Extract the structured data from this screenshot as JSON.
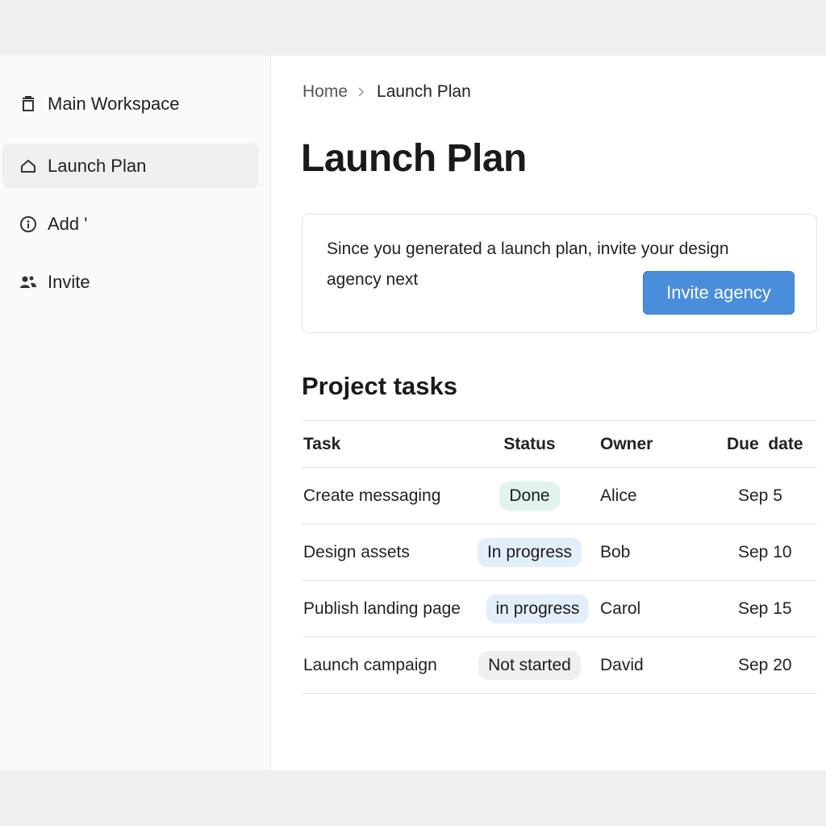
{
  "sidebar": {
    "items": [
      {
        "label": "Main Workspace",
        "icon": "trash-icon"
      },
      {
        "label": "Launch Plan",
        "icon": "home-icon",
        "active": true
      },
      {
        "label": "Add '",
        "icon": "info-circle-icon"
      },
      {
        "label": "Invite",
        "icon": "users-icon"
      }
    ]
  },
  "breadcrumb": {
    "home": "Home",
    "current": "Launch Plan"
  },
  "page": {
    "title": "Launch Plan"
  },
  "callout": {
    "text": "Since you generated a launch plan, invite your design agency next",
    "button_label": "Invite agency"
  },
  "tasks": {
    "title": "Project tasks",
    "columns": [
      "Task",
      "Status",
      "Owner",
      "Due  date"
    ],
    "rows": [
      {
        "task": "Create messaging",
        "status": "Done",
        "owner": "Alice",
        "due": "Sep 5"
      },
      {
        "task": "Design assets",
        "status": "In progress",
        "owner": "Bob",
        "due": "Sep 10"
      },
      {
        "task": "Publish landing page",
        "status": "in progress",
        "owner": "Carol",
        "due": "Sep 15"
      },
      {
        "task": "Launch campaign",
        "status": "Not started",
        "owner": "David",
        "due": "Sep 20"
      }
    ]
  },
  "colors": {
    "accent": "#4a8edb",
    "done_badge": "#e2f4ea",
    "progress_badge": "#e3eefb",
    "not_started_badge": "#efefef"
  }
}
